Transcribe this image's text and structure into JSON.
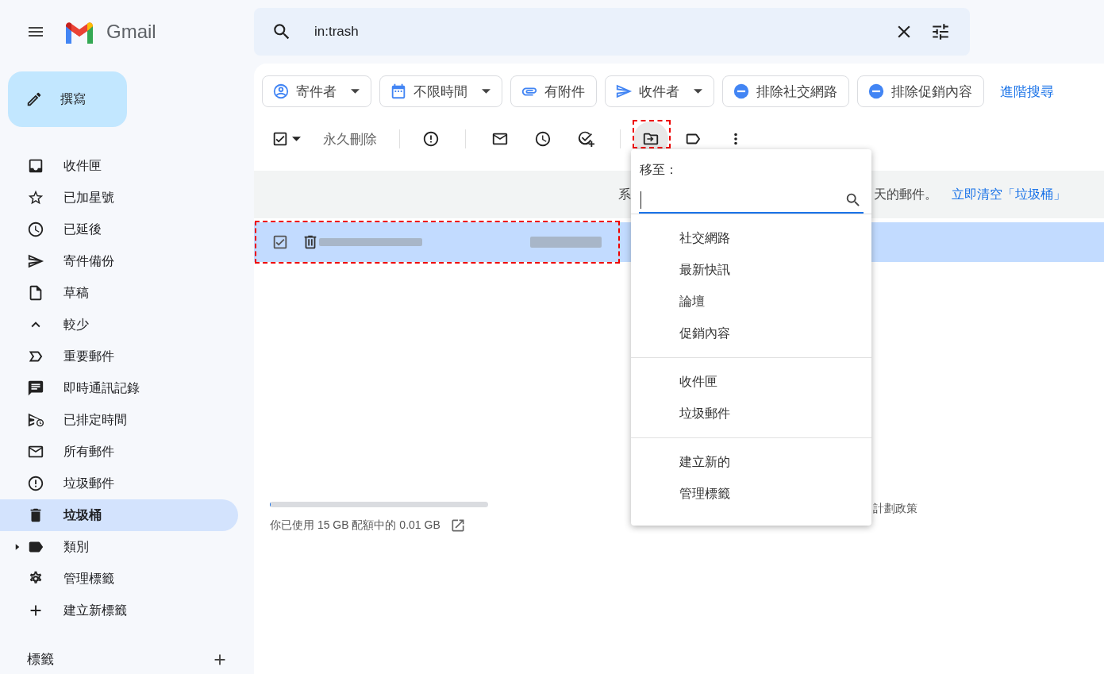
{
  "header": {
    "app_name": "Gmail",
    "search": {
      "value": "in:trash"
    }
  },
  "compose": {
    "label": "撰寫"
  },
  "sidebar": {
    "items": [
      {
        "label": "收件匣",
        "kind": "item",
        "selected": false
      },
      {
        "label": "已加星號",
        "kind": "item",
        "selected": false
      },
      {
        "label": "已延後",
        "kind": "item",
        "selected": false
      },
      {
        "label": "寄件備份",
        "kind": "item",
        "selected": false
      },
      {
        "label": "草稿",
        "kind": "item",
        "selected": false
      },
      {
        "label": "較少",
        "kind": "item",
        "selected": false
      },
      {
        "label": "重要郵件",
        "kind": "item",
        "selected": false
      },
      {
        "label": "即時通訊記錄",
        "kind": "item",
        "selected": false
      },
      {
        "label": "已排定時間",
        "kind": "item",
        "selected": false
      },
      {
        "label": "所有郵件",
        "kind": "item",
        "selected": false
      },
      {
        "label": "垃圾郵件",
        "kind": "item",
        "selected": false
      },
      {
        "label": "垃圾桶",
        "kind": "item",
        "selected": true
      },
      {
        "label": "類別",
        "kind": "group",
        "expanded": false,
        "selected": false
      },
      {
        "label": "管理標籤",
        "kind": "item",
        "selected": false
      },
      {
        "label": "建立新標籤",
        "kind": "item",
        "selected": false
      }
    ],
    "labels_heading": "標籤"
  },
  "filters": [
    {
      "label": "寄件者",
      "dropdown": true
    },
    {
      "label": "不限時間",
      "dropdown": true
    },
    {
      "label": "有附件",
      "dropdown": false
    },
    {
      "label": "收件者",
      "dropdown": true
    },
    {
      "label": "排除社交網路",
      "dropdown": false
    },
    {
      "label": "排除促銷內容",
      "dropdown": false
    }
  ],
  "advanced_search": "進階搜尋",
  "toolbar": {
    "delete_forever": "永久刪除",
    "select_all_checked": true
  },
  "banner": {
    "text_start": "系",
    "text_end": "天的郵件。",
    "link": "立即清空「垃圾桶」"
  },
  "message_rows": [
    {
      "selected": true,
      "checked": true
    }
  ],
  "footer": {
    "storage": "你已使用 15 GB 配額中的 0.01 GB",
    "level": 0.001,
    "policy": "計劃政策"
  },
  "move_menu": {
    "title": "移至：",
    "groups": [
      [
        "社交網路",
        "最新快訊",
        "論壇",
        "促銷內容"
      ],
      [
        "收件匣",
        "垃圾郵件"
      ],
      [
        "建立新的",
        "管理標籤"
      ]
    ]
  }
}
